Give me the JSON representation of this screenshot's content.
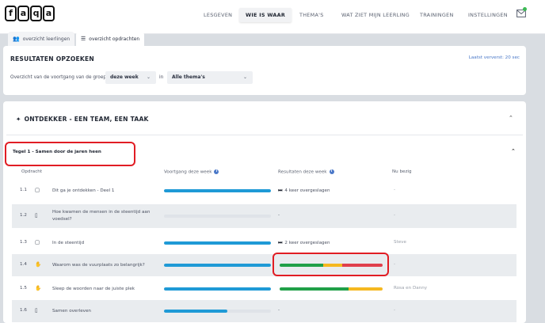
{
  "logo": [
    "f",
    "a",
    "q",
    "a"
  ],
  "nav": [
    "LESGEVEN",
    "WIE IS WAAR",
    "THEMA'S",
    "WAT ZIET MIJN LEERLING",
    "TRAININGEN",
    "INSTELLINGEN"
  ],
  "nav_active": "WIE IS WAAR",
  "tabs": [
    {
      "label": "overzicht leerlingen",
      "icon": "users-icon"
    },
    {
      "label": "overzicht opdrachten",
      "icon": "list-icon",
      "active": true
    }
  ],
  "search": {
    "title": "RESULTATEN OPZOEKEN",
    "last_refreshed": "Laatst ververst: 20 sec",
    "filter_prefix": "Overzicht van de voortgang van de groep",
    "period_value": "deze week",
    "in_label": "in",
    "theme_value": "Alle thema's"
  },
  "theme": {
    "title": "ONTDEKKER - EEN TEAM, EEN TAAK",
    "icon": "compass-icon"
  },
  "tile": {
    "title": "Tegel 1 - Samen door de jaren heen"
  },
  "columns": {
    "assignment": "Opdracht",
    "progress": "Voortgang deze week",
    "results": "Resultaten deze week",
    "busy": "Nu bezig"
  },
  "colors": {
    "progress": "#1f9ad6",
    "green": "#20a048",
    "yellow": "#f5b820",
    "red": "#e0404c",
    "highlight": "#e11d24"
  },
  "rows": [
    {
      "num": "1.1",
      "icon": "presentation-icon",
      "text": "Dit ga je ontdekken - Deel 1",
      "progress": 1.0,
      "result_text": "4 keer overgeslagen",
      "busy": "-"
    },
    {
      "num": "1.2",
      "icon": "document-icon",
      "text": "Hoe kwamen de mensen in de steentijd aan voedsel?",
      "progress": 0.0,
      "result_text": "-",
      "busy": "-"
    },
    {
      "num": "1.3",
      "icon": "presentation-icon",
      "text": "In de steentijd",
      "progress": 1.0,
      "result_text": "2 keer overgeslagen",
      "busy": "Steve"
    },
    {
      "num": "1.4",
      "icon": "hand-icon",
      "text": "Waarom was de vuurplaats zo belangrijk?",
      "progress": 1.0,
      "result_segments": [
        0.42,
        0.19,
        0.39
      ],
      "busy": "-"
    },
    {
      "num": "1.5",
      "icon": "hand-icon",
      "text": "Sleep de woorden naar de juiste plek",
      "progress": 1.0,
      "result_segments": [
        0.67,
        0.33,
        0.0
      ],
      "busy": "Rosa en Danny"
    },
    {
      "num": "1.6",
      "icon": "document-icon",
      "text": "Samen overleven",
      "progress": 0.59,
      "result_text": "-",
      "busy": "-"
    }
  ]
}
